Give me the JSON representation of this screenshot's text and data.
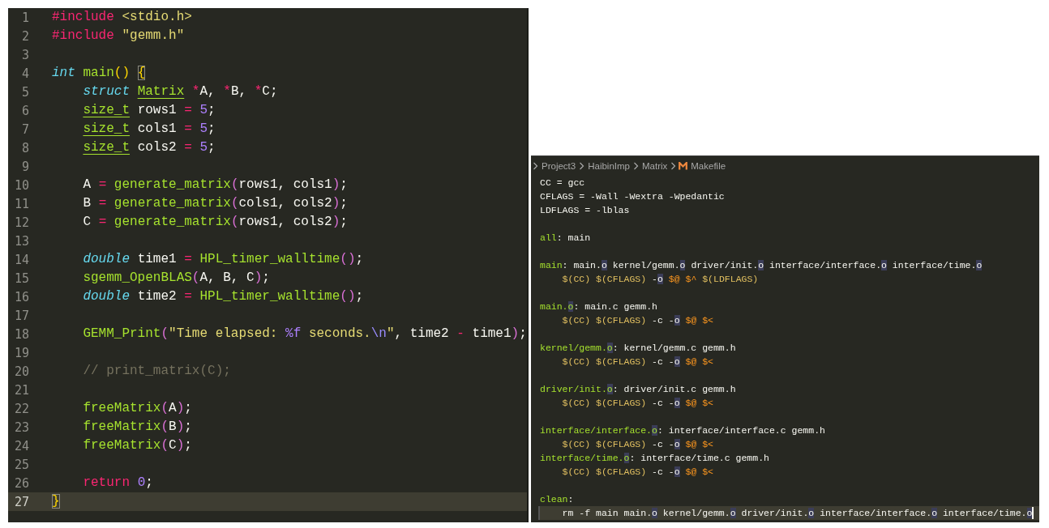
{
  "c_editor": {
    "lines": [
      {
        "number": "1",
        "current": false,
        "tokens": [
          {
            "text": "#include",
            "kind": "kw"
          },
          {
            "text": " <stdio.h>",
            "kind": "str"
          }
        ]
      },
      {
        "number": "2",
        "current": false,
        "tokens": [
          {
            "text": "#include",
            "kind": "kw"
          },
          {
            "text": " \"gemm.h\"",
            "kind": "str"
          }
        ]
      },
      {
        "number": "3",
        "current": false
      },
      {
        "number": "4",
        "current": false,
        "tokens": [
          {
            "text": "int",
            "kind": "type"
          },
          {
            "text": " main",
            "kind": "fn"
          },
          {
            "text": "()",
            "kind": "br1"
          },
          {
            "text": " {",
            "kind": "br1-match"
          }
        ]
      },
      {
        "number": "5",
        "current": false,
        "tokens": [
          {
            "text": "    struct",
            "kind": "type"
          },
          {
            "text": " Matrix",
            "kind": "type-link"
          },
          {
            "text": " *",
            "kind": "kw"
          },
          {
            "text": "A,",
            "kind": "plain"
          },
          {
            "text": " *",
            "kind": "kw"
          },
          {
            "text": "B,",
            "kind": "plain"
          },
          {
            "text": " *",
            "kind": "kw"
          },
          {
            "text": "C;",
            "kind": "plain"
          }
        ]
      },
      {
        "number": "6",
        "current": false,
        "tokens": [
          {
            "text": "    size_t",
            "kind": "type-link"
          },
          {
            "text": " rows1 ",
            "kind": "plain"
          },
          {
            "text": "=",
            "kind": "kw"
          },
          {
            "text": " 5",
            "kind": "num"
          },
          {
            "text": ";",
            "kind": "plain"
          }
        ]
      },
      {
        "number": "7",
        "current": false,
        "tokens": [
          {
            "text": "    size_t",
            "kind": "type-link"
          },
          {
            "text": " cols1 ",
            "kind": "plain"
          },
          {
            "text": "=",
            "kind": "kw"
          },
          {
            "text": " 5",
            "kind": "num"
          },
          {
            "text": ";",
            "kind": "plain"
          }
        ]
      },
      {
        "number": "8",
        "current": false,
        "tokens": [
          {
            "text": "    size_t",
            "kind": "type-link"
          },
          {
            "text": " cols2 ",
            "kind": "plain"
          },
          {
            "text": "=",
            "kind": "kw"
          },
          {
            "text": " 5",
            "kind": "num"
          },
          {
            "text": ";",
            "kind": "plain"
          }
        ]
      },
      {
        "number": "9",
        "current": false
      },
      {
        "number": "10",
        "current": false,
        "tokens": [
          {
            "text": "    A ",
            "kind": "plain"
          },
          {
            "text": "=",
            "kind": "kw"
          },
          {
            "text": " generate_matrix",
            "kind": "fn"
          },
          {
            "text": "(",
            "kind": "br2"
          },
          {
            "text": "rows1, cols1",
            "kind": "plain"
          },
          {
            "text": ")",
            "kind": "br2"
          },
          {
            "text": ";",
            "kind": "plain"
          }
        ]
      },
      {
        "number": "11",
        "current": false,
        "tokens": [
          {
            "text": "    B ",
            "kind": "plain"
          },
          {
            "text": "=",
            "kind": "kw"
          },
          {
            "text": " generate_matrix",
            "kind": "fn"
          },
          {
            "text": "(",
            "kind": "br2"
          },
          {
            "text": "cols1, cols2",
            "kind": "plain"
          },
          {
            "text": ")",
            "kind": "br2"
          },
          {
            "text": ";",
            "kind": "plain"
          }
        ]
      },
      {
        "number": "12",
        "current": false,
        "tokens": [
          {
            "text": "    C ",
            "kind": "plain"
          },
          {
            "text": "=",
            "kind": "kw"
          },
          {
            "text": " generate_matrix",
            "kind": "fn"
          },
          {
            "text": "(",
            "kind": "br2"
          },
          {
            "text": "rows1, cols2",
            "kind": "plain"
          },
          {
            "text": ")",
            "kind": "br2"
          },
          {
            "text": ";",
            "kind": "plain"
          }
        ]
      },
      {
        "number": "13",
        "current": false
      },
      {
        "number": "14",
        "current": false,
        "tokens": [
          {
            "text": "    double",
            "kind": "type"
          },
          {
            "text": " time1 ",
            "kind": "plain"
          },
          {
            "text": "=",
            "kind": "kw"
          },
          {
            "text": " HPL_timer_walltime",
            "kind": "fn"
          },
          {
            "text": "()",
            "kind": "br2"
          },
          {
            "text": ";",
            "kind": "plain"
          }
        ]
      },
      {
        "number": "15",
        "current": false,
        "tokens": [
          {
            "text": "    sgemm_OpenBLAS",
            "kind": "fn"
          },
          {
            "text": "(",
            "kind": "br2"
          },
          {
            "text": "A, B, C",
            "kind": "plain"
          },
          {
            "text": ")",
            "kind": "br2"
          },
          {
            "text": ";",
            "kind": "plain"
          }
        ]
      },
      {
        "number": "16",
        "current": false,
        "tokens": [
          {
            "text": "    double",
            "kind": "type"
          },
          {
            "text": " time2 ",
            "kind": "plain"
          },
          {
            "text": "=",
            "kind": "kw"
          },
          {
            "text": " HPL_timer_walltime",
            "kind": "fn"
          },
          {
            "text": "()",
            "kind": "br2"
          },
          {
            "text": ";",
            "kind": "plain"
          }
        ]
      },
      {
        "number": "17",
        "current": false
      },
      {
        "number": "18",
        "current": false,
        "tokens": [
          {
            "text": "    GEMM_Print",
            "kind": "fn"
          },
          {
            "text": "(",
            "kind": "br2"
          },
          {
            "text": "\"Time elapsed: ",
            "kind": "str"
          },
          {
            "text": "%f",
            "kind": "num"
          },
          {
            "text": " seconds.",
            "kind": "str"
          },
          {
            "text": "\\n",
            "kind": "esc"
          },
          {
            "text": "\"",
            "kind": "str"
          },
          {
            "text": ", time2 ",
            "kind": "plain"
          },
          {
            "text": "-",
            "kind": "kw"
          },
          {
            "text": " time1",
            "kind": "plain"
          },
          {
            "text": ")",
            "kind": "br2"
          },
          {
            "text": ";",
            "kind": "plain"
          }
        ]
      },
      {
        "number": "19",
        "current": false
      },
      {
        "number": "20",
        "current": false,
        "tokens": [
          {
            "text": "    // print_matrix(C);",
            "kind": "comment"
          }
        ]
      },
      {
        "number": "21",
        "current": false
      },
      {
        "number": "22",
        "current": false,
        "tokens": [
          {
            "text": "    freeMatrix",
            "kind": "fn"
          },
          {
            "text": "(",
            "kind": "br2"
          },
          {
            "text": "A",
            "kind": "plain"
          },
          {
            "text": ")",
            "kind": "br2"
          },
          {
            "text": ";",
            "kind": "plain"
          }
        ]
      },
      {
        "number": "23",
        "current": false,
        "tokens": [
          {
            "text": "    freeMatrix",
            "kind": "fn"
          },
          {
            "text": "(",
            "kind": "br2"
          },
          {
            "text": "B",
            "kind": "plain"
          },
          {
            "text": ")",
            "kind": "br2"
          },
          {
            "text": ";",
            "kind": "plain"
          }
        ]
      },
      {
        "number": "24",
        "current": false,
        "tokens": [
          {
            "text": "    freeMatrix",
            "kind": "fn"
          },
          {
            "text": "(",
            "kind": "br2"
          },
          {
            "text": "C",
            "kind": "plain"
          },
          {
            "text": ")",
            "kind": "br2"
          },
          {
            "text": ";",
            "kind": "plain"
          }
        ]
      },
      {
        "number": "25",
        "current": false
      },
      {
        "number": "26",
        "current": false,
        "tokens": [
          {
            "text": "    return",
            "kind": "kw"
          },
          {
            "text": " 0",
            "kind": "num"
          },
          {
            "text": ";",
            "kind": "plain"
          }
        ]
      },
      {
        "number": "27",
        "current": true,
        "tokens": [
          {
            "text": "}",
            "kind": "br1-match"
          }
        ]
      }
    ]
  },
  "makefile_editor": {
    "breadcrumb": [
      {
        "label": "Project3",
        "kind": "folder"
      },
      {
        "label": "HaibinImp",
        "kind": "folder"
      },
      {
        "label": "Matrix",
        "kind": "folder"
      },
      {
        "label": "Makefile",
        "kind": "makefile"
      }
    ],
    "lines": [
      {
        "current": false,
        "tokens": [
          {
            "text": "CC = gcc",
            "kind": "plain"
          }
        ]
      },
      {
        "current": false,
        "tokens": [
          {
            "text": "CFLAGS = -Wall -Wextra -Wpedantic",
            "kind": "plain"
          }
        ]
      },
      {
        "current": false,
        "tokens": [
          {
            "text": "LDFLAGS = -lblas",
            "kind": "plain"
          }
        ]
      },
      {
        "current": false
      },
      {
        "current": false,
        "tokens": [
          {
            "text": "all",
            "kind": "target"
          },
          {
            "text": ": main",
            "kind": "plain"
          }
        ]
      },
      {
        "current": false
      },
      {
        "current": false,
        "tokens": [
          {
            "text": "main",
            "kind": "target"
          },
          {
            "text": ": main.",
            "kind": "plain"
          },
          {
            "text": "o",
            "kind": "match"
          },
          {
            "text": " kernel/gemm.",
            "kind": "plain"
          },
          {
            "text": "o",
            "kind": "match"
          },
          {
            "text": " driver/init.",
            "kind": "plain"
          },
          {
            "text": "o",
            "kind": "match"
          },
          {
            "text": " interface/interface.",
            "kind": "plain"
          },
          {
            "text": "o",
            "kind": "match"
          },
          {
            "text": " interface/time.",
            "kind": "plain"
          },
          {
            "text": "o",
            "kind": "match"
          }
        ]
      },
      {
        "current": false,
        "tokens": [
          {
            "text": "    $(CC)",
            "kind": "var"
          },
          {
            "text": " $(CFLAGS)",
            "kind": "var"
          },
          {
            "text": " -",
            "kind": "plain"
          },
          {
            "text": "o",
            "kind": "match"
          },
          {
            "text": " $@",
            "kind": "auto"
          },
          {
            "text": " $^",
            "kind": "auto"
          },
          {
            "text": " $(LDFLAGS)",
            "kind": "var"
          }
        ]
      },
      {
        "current": false
      },
      {
        "current": false,
        "tokens": [
          {
            "text": "main.",
            "kind": "target"
          },
          {
            "text": "o",
            "kind": "target-match"
          },
          {
            "text": ": main.c gemm.h",
            "kind": "plain"
          }
        ]
      },
      {
        "current": false,
        "tokens": [
          {
            "text": "    $(CC)",
            "kind": "var"
          },
          {
            "text": " $(CFLAGS)",
            "kind": "var"
          },
          {
            "text": " -c -",
            "kind": "plain"
          },
          {
            "text": "o",
            "kind": "match"
          },
          {
            "text": " $@",
            "kind": "auto"
          },
          {
            "text": " $<",
            "kind": "auto"
          }
        ]
      },
      {
        "current": false
      },
      {
        "current": false,
        "tokens": [
          {
            "text": "kernel/gemm.",
            "kind": "target"
          },
          {
            "text": "o",
            "kind": "target-match"
          },
          {
            "text": ": kernel/gemm.c gemm.h",
            "kind": "plain"
          }
        ]
      },
      {
        "current": false,
        "tokens": [
          {
            "text": "    $(CC)",
            "kind": "var"
          },
          {
            "text": " $(CFLAGS)",
            "kind": "var"
          },
          {
            "text": " -c -",
            "kind": "plain"
          },
          {
            "text": "o",
            "kind": "match"
          },
          {
            "text": " $@",
            "kind": "auto"
          },
          {
            "text": " $<",
            "kind": "auto"
          }
        ]
      },
      {
        "current": false
      },
      {
        "current": false,
        "tokens": [
          {
            "text": "driver/init.",
            "kind": "target"
          },
          {
            "text": "o",
            "kind": "target-match"
          },
          {
            "text": ": driver/init.c gemm.h",
            "kind": "plain"
          }
        ]
      },
      {
        "current": false,
        "tokens": [
          {
            "text": "    $(CC)",
            "kind": "var"
          },
          {
            "text": " $(CFLAGS)",
            "kind": "var"
          },
          {
            "text": " -c -",
            "kind": "plain"
          },
          {
            "text": "o",
            "kind": "match"
          },
          {
            "text": " $@",
            "kind": "auto"
          },
          {
            "text": " $<",
            "kind": "auto"
          }
        ]
      },
      {
        "current": false
      },
      {
        "current": false,
        "tokens": [
          {
            "text": "interface/interface.",
            "kind": "target"
          },
          {
            "text": "o",
            "kind": "target-match"
          },
          {
            "text": ": interface/interface.c gemm.h",
            "kind": "plain"
          }
        ]
      },
      {
        "current": false,
        "tokens": [
          {
            "text": "    $(CC)",
            "kind": "var"
          },
          {
            "text": " $(CFLAGS)",
            "kind": "var"
          },
          {
            "text": " -c -",
            "kind": "plain"
          },
          {
            "text": "o",
            "kind": "match"
          },
          {
            "text": " $@",
            "kind": "auto"
          },
          {
            "text": " $<",
            "kind": "auto"
          }
        ]
      },
      {
        "current": false,
        "tokens": [
          {
            "text": "interface/time.",
            "kind": "target"
          },
          {
            "text": "o",
            "kind": "target-match"
          },
          {
            "text": ": interface/time.c gemm.h",
            "kind": "plain"
          }
        ]
      },
      {
        "current": false,
        "tokens": [
          {
            "text": "    $(CC)",
            "kind": "var"
          },
          {
            "text": " $(CFLAGS)",
            "kind": "var"
          },
          {
            "text": " -c -",
            "kind": "plain"
          },
          {
            "text": "o",
            "kind": "match"
          },
          {
            "text": " $@",
            "kind": "auto"
          },
          {
            "text": " $<",
            "kind": "auto"
          }
        ]
      },
      {
        "current": false
      },
      {
        "current": false,
        "tokens": [
          {
            "text": "clean",
            "kind": "target"
          },
          {
            "text": ":",
            "kind": "plain"
          }
        ]
      },
      {
        "current": true,
        "tokens": [
          {
            "text": "    rm -f main main.",
            "kind": "plain"
          },
          {
            "text": "o",
            "kind": "match"
          },
          {
            "text": " kernel/gemm.",
            "kind": "plain"
          },
          {
            "text": "o",
            "kind": "match"
          },
          {
            "text": " driver/init.",
            "kind": "plain"
          },
          {
            "text": "o",
            "kind": "match"
          },
          {
            "text": " interface/interface.",
            "kind": "plain"
          },
          {
            "text": "o",
            "kind": "match"
          },
          {
            "text": " interface/time.",
            "kind": "plain"
          },
          {
            "text": "o",
            "kind": "match"
          }
        ]
      }
    ]
  }
}
